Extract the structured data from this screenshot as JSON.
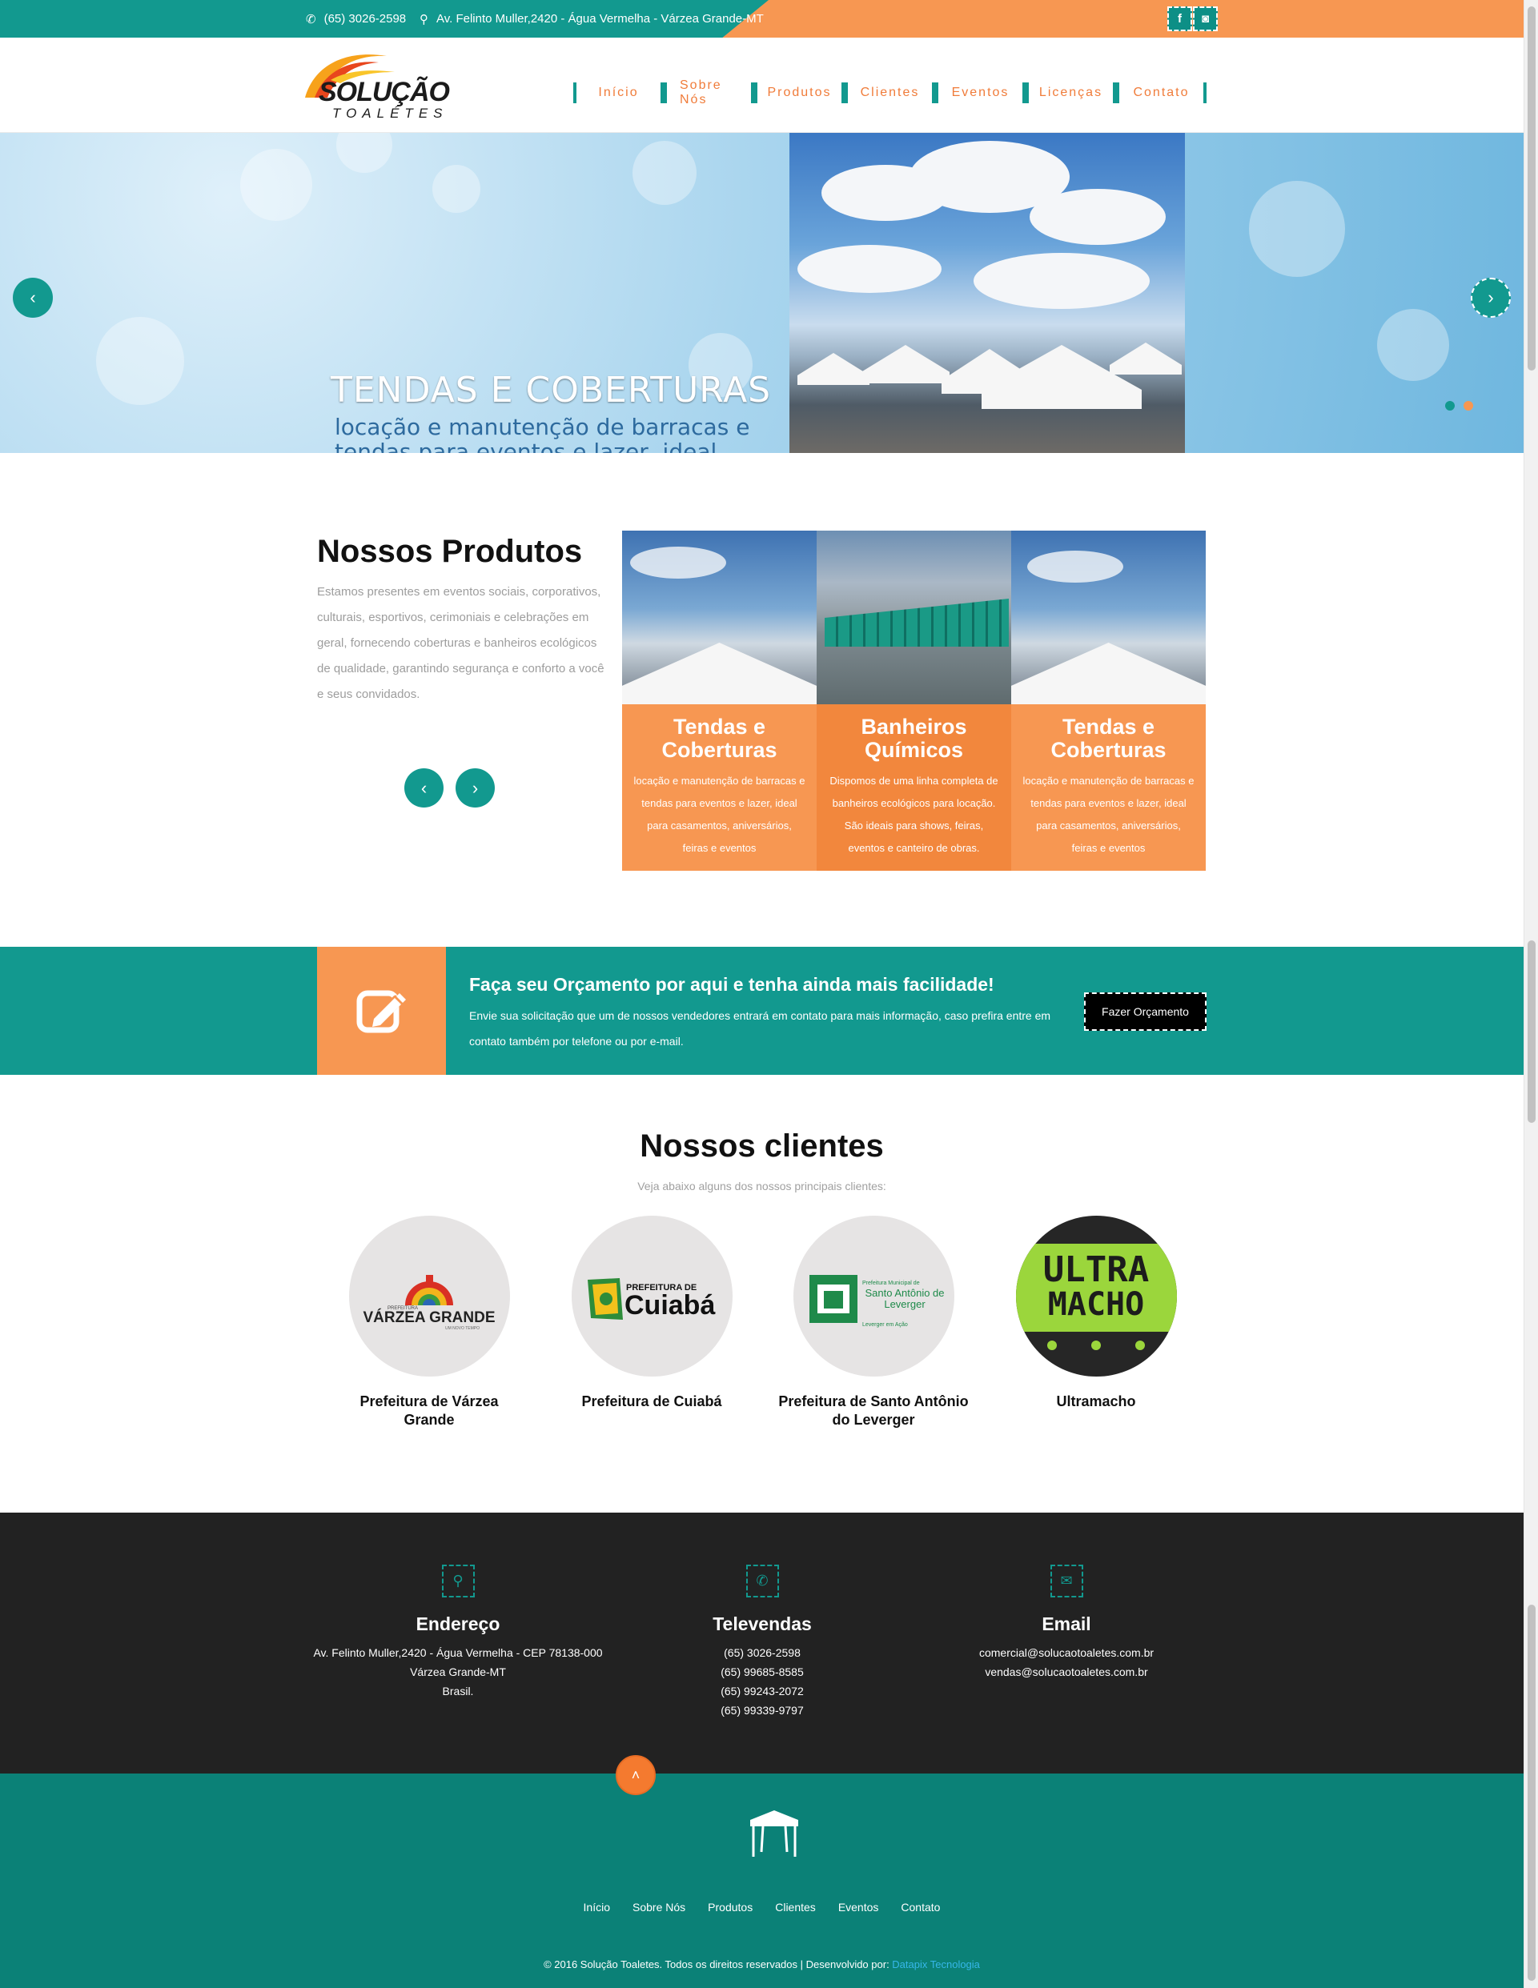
{
  "topbar": {
    "phone": "(65) 3026-2598",
    "address": "Av. Felinto Muller,2420 - Água Vermelha - Várzea Grande-MT",
    "social": [
      {
        "icon": "facebook-icon",
        "glyph": "f"
      },
      {
        "icon": "instagram-icon",
        "glyph": "◙"
      }
    ]
  },
  "logo": {
    "main": "SOLUÇÃO",
    "sub": "TOALÉTES"
  },
  "nav": [
    "Início",
    "Sobre Nós",
    "Produtos",
    "Clientes",
    "Eventos",
    "Licenças",
    "Contato"
  ],
  "slider": {
    "title": "TENDAS E COBERTURAS",
    "text": "locação e manutenção de barracas e tendas para eventos e lazer, ideal para casamentos, aniversários, feiras e eventos",
    "prev_glyph": "‹",
    "next_glyph": "›"
  },
  "produtos": {
    "title": "Nossos Produtos",
    "description": "Estamos presentes em eventos sociais, corporativos, culturais, esportivos, cerimoniais e celebrações em geral, fornecendo coberturas e banheiros ecológicos de qualidade, garantindo segurança e conforto a você e seus convidados.",
    "prev_glyph": "‹",
    "next_glyph": "›",
    "cards": [
      {
        "title": "Tendas e Coberturas",
        "text": "locação e manutenção de barracas e tendas para eventos e lazer, ideal para casamentos, aniversários, feiras e eventos"
      },
      {
        "title": "Banheiros Químicos",
        "text": "Dispomos de uma linha completa de banheiros ecológicos para locação. São ideais para shows, feiras, eventos e canteiro de obras."
      },
      {
        "title": "Tendas e Coberturas",
        "text": "locação e manutenção de barracas e tendas para eventos e lazer, ideal para casamentos, aniversários, feiras e eventos"
      }
    ]
  },
  "cta": {
    "title": "Faça seu Orçamento por aqui e tenha ainda mais facilidade!",
    "text": "Envie sua solicitação que um de nossos vendedores entrará em contato para mais informação, caso prefira entre em contato também por telefone ou por e-mail.",
    "button": "Fazer Orçamento"
  },
  "clientes": {
    "title": "Nossos clientes",
    "subtitle": "Veja abaixo alguns dos nossos principais clientes:",
    "items": [
      {
        "name": "Prefeitura de Várzea Grande",
        "logo_text": "VÁRZEA GRANDE",
        "logo_small": "PREFEITURA",
        "logo_tag": "UM NOVO TEMPO"
      },
      {
        "name": "Prefeitura de Cuiabá",
        "logo_text": "Cuiabá",
        "logo_small": "PREFEITURA DE"
      },
      {
        "name": "Prefeitura de Santo Antônio do Leverger",
        "logo_text": "Santo Antônio de Leverger",
        "logo_small": "Prefeitura Municipal de",
        "logo_tag": "Leverger em Ação"
      },
      {
        "name": "Ultramacho",
        "logo_text": "ULTRA",
        "logo_text2": "MACHO"
      }
    ]
  },
  "contato": {
    "endereco": {
      "title": "Endereço",
      "lines": [
        "Av. Felinto Muller,2420 - Água Vermelha - CEP 78138-000",
        "Várzea Grande-MT",
        "Brasil."
      ]
    },
    "televendas": {
      "title": "Televendas",
      "lines": [
        "(65) 3026-2598",
        "(65) 99685-8585",
        "(65) 99243-2072",
        "(65) 99339-9797"
      ]
    },
    "email": {
      "title": "Email",
      "lines": [
        "comercial@solucaotoaletes.com.br",
        "vendas@solucaotoaletes.com.br"
      ]
    }
  },
  "footer": {
    "nav": [
      "Início",
      "Sobre Nós",
      "Produtos",
      "Clientes",
      "Eventos",
      "Contato"
    ],
    "copyright": "© 2016 Solução Toaletes. Todos os direitos reservados | Desenvolvido por: ",
    "developer": "Datapix Tecnologia",
    "up_glyph": "˄"
  },
  "colors": {
    "teal": "#12998f",
    "orange": "#f79752",
    "dark": "#222222",
    "footer_teal": "#0b8177"
  }
}
